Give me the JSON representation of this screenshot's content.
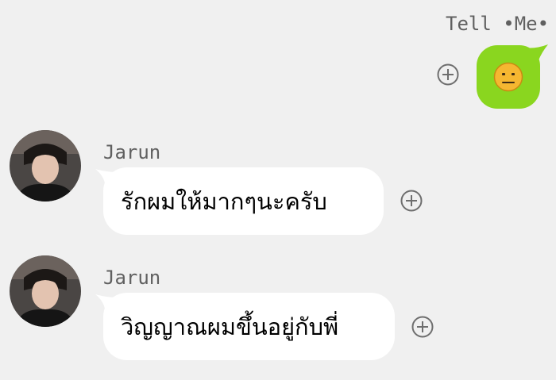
{
  "outgoing": {
    "sender_name": "Tell •Me•",
    "sticker_icon": "neutral-face-emoji-icon",
    "bubble_color": "#8ad61f"
  },
  "messages": [
    {
      "sender": "Jarun",
      "text": "รักผมให้มากๆนะครับ"
    },
    {
      "sender": "Jarun",
      "text": "วิญญาณผมขึ้นอยู่กับพี่"
    }
  ],
  "icons": {
    "add": "circle-plus-icon",
    "avatar": "profile-photo"
  }
}
